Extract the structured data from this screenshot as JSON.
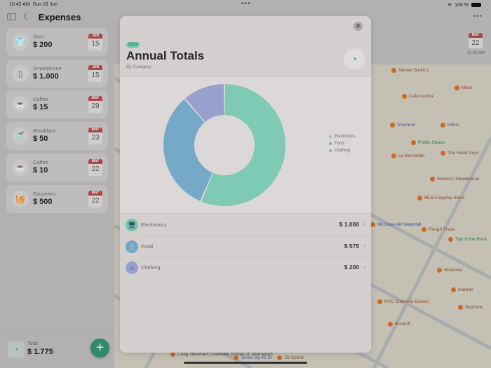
{
  "status": {
    "time": "10:42 AM",
    "date": "Sun 16 Jun",
    "battery": "100 %"
  },
  "sidebar": {
    "title": "Expenses",
    "items": [
      {
        "name": "Shirt",
        "amount": "$ 200",
        "month": "JUN",
        "day": "15",
        "icon": "tshirt-icon",
        "glyph": "👕"
      },
      {
        "name": "Smartphone",
        "amount": "$ 1.000",
        "month": "JUN",
        "day": "15",
        "icon": "smartphone-icon",
        "glyph": "▯"
      },
      {
        "name": "Coffee",
        "amount": "$ 15",
        "month": "MAY",
        "day": "29",
        "icon": "coffee-cup-icon",
        "glyph": "☕"
      },
      {
        "name": "Breakfast",
        "amount": "$ 50",
        "month": "MAY",
        "day": "23",
        "icon": "breakfast-icon",
        "glyph": "🥤"
      },
      {
        "name": "Coffee",
        "amount": "$ 10",
        "month": "MAY",
        "day": "22",
        "icon": "coffee-cup-icon",
        "glyph": "☕"
      },
      {
        "name": "Groceries",
        "amount": "$ 500",
        "month": "MAY",
        "day": "22",
        "icon": "basket-icon",
        "glyph": "🧺"
      }
    ],
    "total_label": "Total",
    "total_amount": "$ 1.775",
    "add_glyph": "+"
  },
  "detail": {
    "month": "MAY",
    "day": "22",
    "time": "12:00 AM",
    "more": "•••"
  },
  "modal": {
    "year": "2024",
    "title": "Annual Totals",
    "subtitle": "By Category",
    "close": "✕",
    "chart_glyph": "◔",
    "rows": [
      {
        "name": "Electronics",
        "amount": "$ 1.000",
        "glyph": "🖥",
        "color": "#74c7ad"
      },
      {
        "name": "Food",
        "amount": "$ 575",
        "glyph": "🍴",
        "color": "#6fa9c9"
      },
      {
        "name": "Clothing",
        "amount": "$ 200",
        "glyph": "⌂",
        "color": "#97a0cd"
      }
    ]
  },
  "chart_data": {
    "type": "pie",
    "variant": "donut",
    "categories": [
      "Electronics",
      "Food",
      "Clothing"
    ],
    "values": [
      1000,
      575,
      200
    ],
    "colors": [
      "#7ecab5",
      "#76a9c8",
      "#98a1cc"
    ],
    "legend": "right"
  },
  "map": {
    "labels": [
      {
        "t": "Tanner Smith's",
        "c": ""
      },
      {
        "t": "Milos",
        "c": ""
      },
      {
        "t": "Cafe Aroma",
        "c": ""
      },
      {
        "t": "Sheraton",
        "c": "pur"
      },
      {
        "t": "Hilton",
        "c": "pur"
      },
      {
        "t": "Public Space",
        "c": "grn"
      },
      {
        "t": "Le Bernardin",
        "c": ""
      },
      {
        "t": "The Halal Guys",
        "c": ""
      },
      {
        "t": "Mastro's Steakhouse",
        "c": ""
      },
      {
        "t": "MLB Flagship Store",
        "c": ""
      },
      {
        "t": "McGraw-Hill Waterfall",
        "c": "blu"
      },
      {
        "t": "Rough Trade",
        "c": ""
      },
      {
        "t": "Top of the Rock",
        "c": "grn"
      },
      {
        "t": "Nintendo",
        "c": ""
      },
      {
        "t": "maman",
        "c": ""
      },
      {
        "t": "NYC Diamond District",
        "c": ""
      },
      {
        "t": "Sephora",
        "c": ""
      },
      {
        "t": "Bookoff",
        "c": ""
      },
      {
        "t": "Craig Newmark Graduate School of Journalism",
        "c": "dk"
      },
      {
        "t": "Times Sq-42 St",
        "c": "blu"
      },
      {
        "t": "JD Sports",
        "c": ""
      }
    ]
  }
}
